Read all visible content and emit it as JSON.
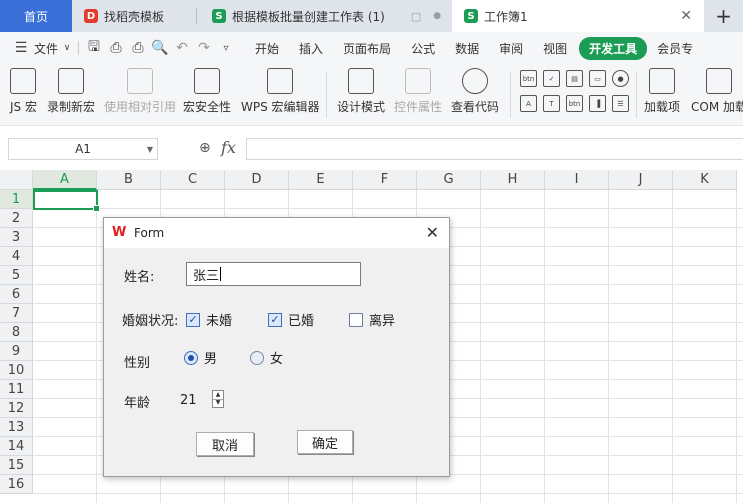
{
  "tabs": {
    "home": "首页",
    "tab1": "找稻壳模板",
    "tab2": "根据模板批量创建工作表 (1)",
    "tab3": "工作簿1"
  },
  "menu": {
    "file": "文件",
    "items": [
      "开始",
      "插入",
      "页面布局",
      "公式",
      "数据",
      "审阅",
      "视图"
    ],
    "active": "开发工具",
    "member": "会员专"
  },
  "ribbon": {
    "js_macro": "JS 宏",
    "record_macro": "录制新宏",
    "relative_ref": "使用相对引用",
    "macro_security": "宏安全性",
    "wps_macro_editor": "WPS 宏编辑器",
    "design_mode": "设计模式",
    "control_props": "控件属性",
    "view_code": "查看代码",
    "addins": "加载项",
    "com_addins": "COM 加载"
  },
  "formula_bar": {
    "cell_ref": "A1",
    "fx": "fx"
  },
  "grid": {
    "columns": [
      "A",
      "B",
      "C",
      "D",
      "E",
      "F",
      "G",
      "H",
      "I",
      "J",
      "K"
    ],
    "rows": [
      "1",
      "2",
      "3",
      "4",
      "5",
      "6",
      "7",
      "8",
      "9",
      "10",
      "11",
      "12",
      "13",
      "14",
      "15",
      "16"
    ]
  },
  "dialog": {
    "title": "Form",
    "name_label": "姓名:",
    "name_value": "张三",
    "marital_label": "婚姻状况:",
    "marital_options": [
      {
        "label": "未婚",
        "checked": true
      },
      {
        "label": "已婚",
        "checked": true
      },
      {
        "label": "离异",
        "checked": false
      }
    ],
    "gender_label": "性别",
    "gender_options": [
      {
        "label": "男",
        "selected": true
      },
      {
        "label": "女",
        "selected": false
      }
    ],
    "age_label": "年龄",
    "age_value": "21",
    "cancel_button": "取消",
    "ok_button": "确定"
  },
  "colors": {
    "accent_green": "#1c9d55",
    "home_tab_blue": "#3b6fd8",
    "wps_red": "#e0201f",
    "checkbox_blue": "#3a70c8"
  }
}
